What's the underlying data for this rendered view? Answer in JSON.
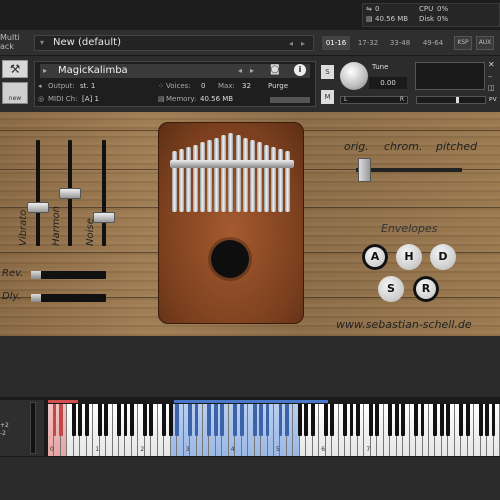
{
  "status": {
    "midi_count": "0",
    "memory": "40.56 MB",
    "cpu_label": "CPU",
    "cpu_value": "0%",
    "disk_label": "Disk",
    "disk_value": "0%"
  },
  "rack": {
    "label_line1": "Multi",
    "label_line2": "ack",
    "preset_name": "New (default)",
    "tabs": [
      "01-16",
      "17-32",
      "33-48",
      "49-64"
    ],
    "active_tab": "01-16",
    "ksp_label": "KSP",
    "aux_label": "AUX"
  },
  "instrument": {
    "new_label": "new",
    "name": "MagicKalimba",
    "output_label": "Output:",
    "output_value": "st. 1",
    "voices_label": "Voices:",
    "voices_value": "0",
    "max_label": "Max:",
    "max_value": "32",
    "purge_label": "Purge",
    "midi_label": "MIDI Ch:",
    "midi_value": "[A] 1",
    "memory_label": "Memory:",
    "memory_value": "40.56 MB",
    "solo_label": "S",
    "mute_label": "M",
    "tune_label": "Tune",
    "tune_value": "0.00",
    "lr_left": "L",
    "lr_right": "R"
  },
  "panel": {
    "sliders": [
      {
        "label": "Vibrato"
      },
      {
        "label": "Harmon"
      },
      {
        "label": "Noise"
      }
    ],
    "rev_label": "Rev.",
    "dly_label": "Dly.",
    "modes": [
      "orig.",
      "chrom.",
      "pitched"
    ],
    "envelopes_title": "Envelopes",
    "envelope_buttons": [
      "A",
      "H",
      "D",
      "S",
      "R"
    ],
    "url": "www.sebastian-schell.de"
  },
  "keyboard": {
    "pitch_labels": [
      "+2",
      "-2"
    ],
    "octave_labels": [
      "0",
      "1",
      "2",
      "3",
      "4",
      "5",
      "6",
      "7"
    ],
    "red_range": "keyswitch range",
    "blue_range": "playable range"
  },
  "colors": {
    "wood": "#9b7a50",
    "keyswitch_red": "#d05050",
    "playable_blue": "#4a78c8"
  }
}
